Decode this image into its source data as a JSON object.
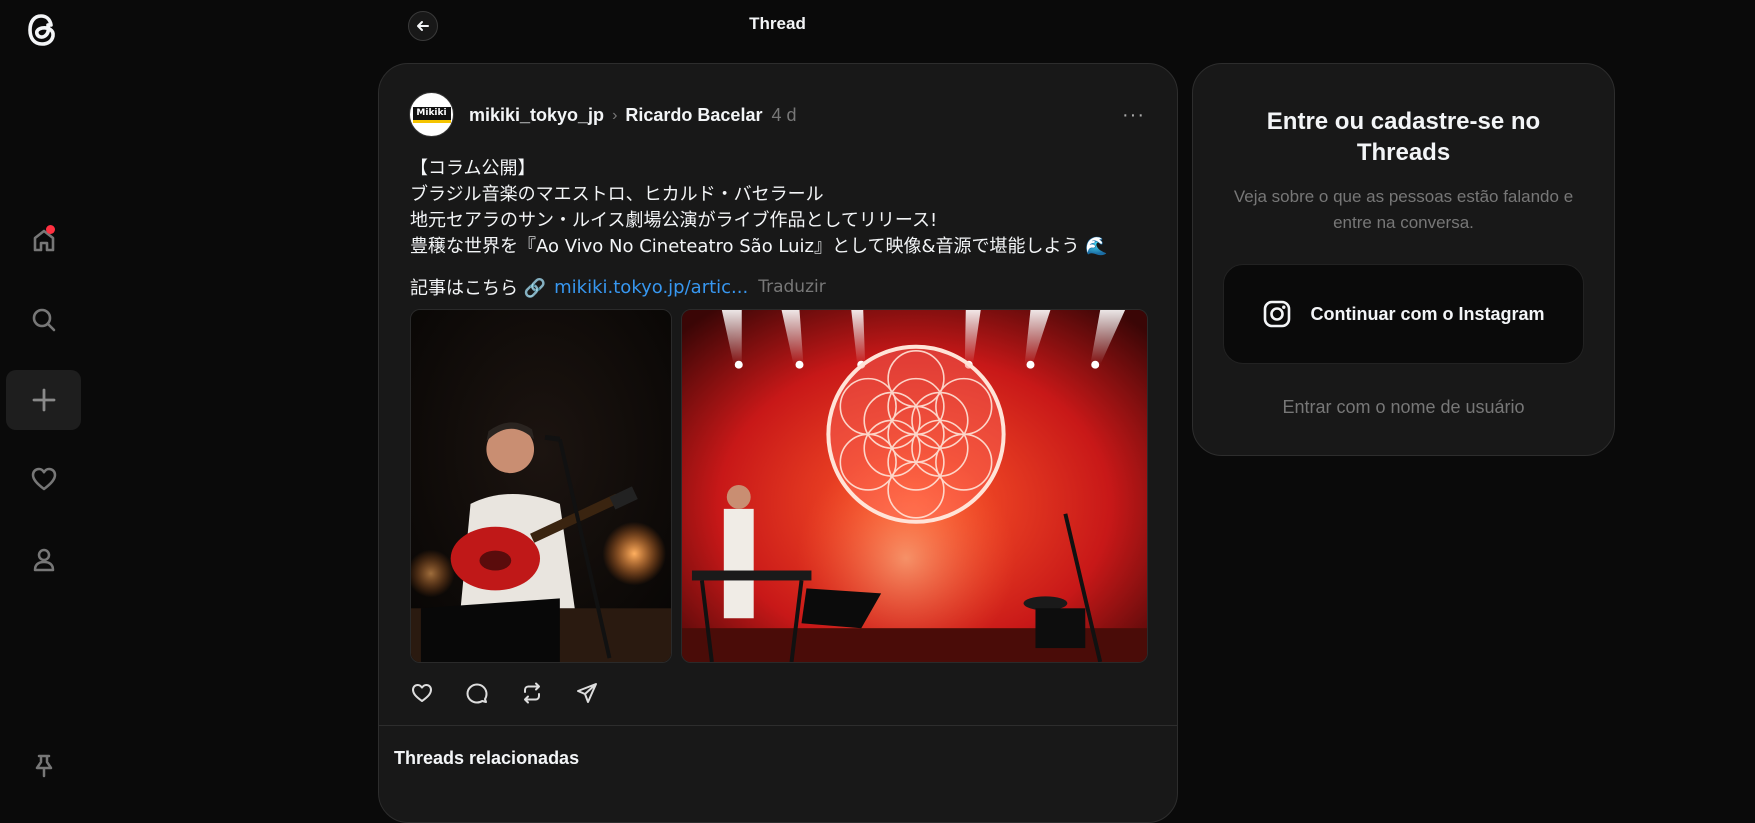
{
  "page": {
    "title": "Thread"
  },
  "sidebar": {
    "items": [
      {
        "name": "home",
        "icon": "home-icon",
        "has_notification": true
      },
      {
        "name": "search",
        "icon": "search-icon"
      },
      {
        "name": "create",
        "icon": "plus-icon"
      },
      {
        "name": "activity",
        "icon": "heart-icon"
      },
      {
        "name": "profile",
        "icon": "user-icon"
      },
      {
        "name": "pin",
        "icon": "pin-icon"
      }
    ],
    "notification_color": "#ff3040"
  },
  "post": {
    "avatar_text": "Mikiki",
    "username": "mikiki_tokyo_jp",
    "reply_to": "Ricardo Bacelar",
    "timestamp": "4 d",
    "more": "···",
    "lines": [
      "【コラム公開】",
      "ブラジル音楽のマエストロ、ヒカルド・バセラール",
      "地元セアラのサン・ルイス劇場公演がライブ作品としてリリース!",
      "豊穣な世界を『Ao Vivo No Cineteatro São Luiz』として映像&音源で堪能しよう 🌊"
    ],
    "link_prefix": "記事はこちら 🔗",
    "link_text": "mikiki.tokyo.jp/artic...",
    "translate": "Traduzir",
    "actions": [
      "heart-icon",
      "comment-icon",
      "repost-icon",
      "share-icon"
    ]
  },
  "related": {
    "title": "Threads relacionadas"
  },
  "login": {
    "title": "Entre ou cadastre-se no Threads",
    "subtitle": "Veja sobre o que as pessoas estão falando e entre na conversa.",
    "instagram_button": "Continuar com o Instagram",
    "username_link": "Entrar com o nome de usuário"
  },
  "colors": {
    "background": "#0a0a0a",
    "card": "#181818",
    "link": "#3797f0",
    "muted": "#777777"
  }
}
